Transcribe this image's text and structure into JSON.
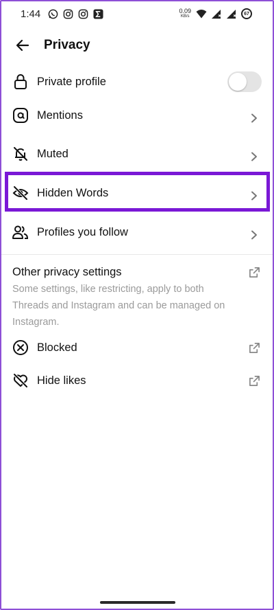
{
  "status_bar": {
    "time": "1:44",
    "net_speed": "0.09",
    "net_unit": "KB/s",
    "battery": "67"
  },
  "header": {
    "title": "Privacy"
  },
  "rows": [
    {
      "label": "Private profile",
      "icon": "lock-icon",
      "control": "toggle",
      "toggle_on": false
    },
    {
      "label": "Mentions",
      "icon": "at-sign-icon",
      "control": "chevron"
    },
    {
      "label": "Muted",
      "icon": "bell-off-icon",
      "control": "chevron"
    },
    {
      "label": "Hidden Words",
      "icon": "eye-off-icon",
      "control": "chevron",
      "highlighted": true
    },
    {
      "label": "Profiles you follow",
      "icon": "people-icon",
      "control": "chevron"
    }
  ],
  "other_section": {
    "title": "Other privacy settings",
    "description": "Some settings, like restricting, apply to both Threads and Instagram and can be managed on Instagram.",
    "items": [
      {
        "label": "Blocked",
        "icon": "blocked-circle-icon",
        "control": "external-link"
      },
      {
        "label": "Hide likes",
        "icon": "heart-off-icon",
        "control": "external-link"
      }
    ]
  },
  "colors": {
    "highlight": "#7a18d6",
    "frame_border": "#8e4fd6",
    "secondary_text": "#9a9a9a",
    "toggle_off": "#e4e4e4"
  }
}
